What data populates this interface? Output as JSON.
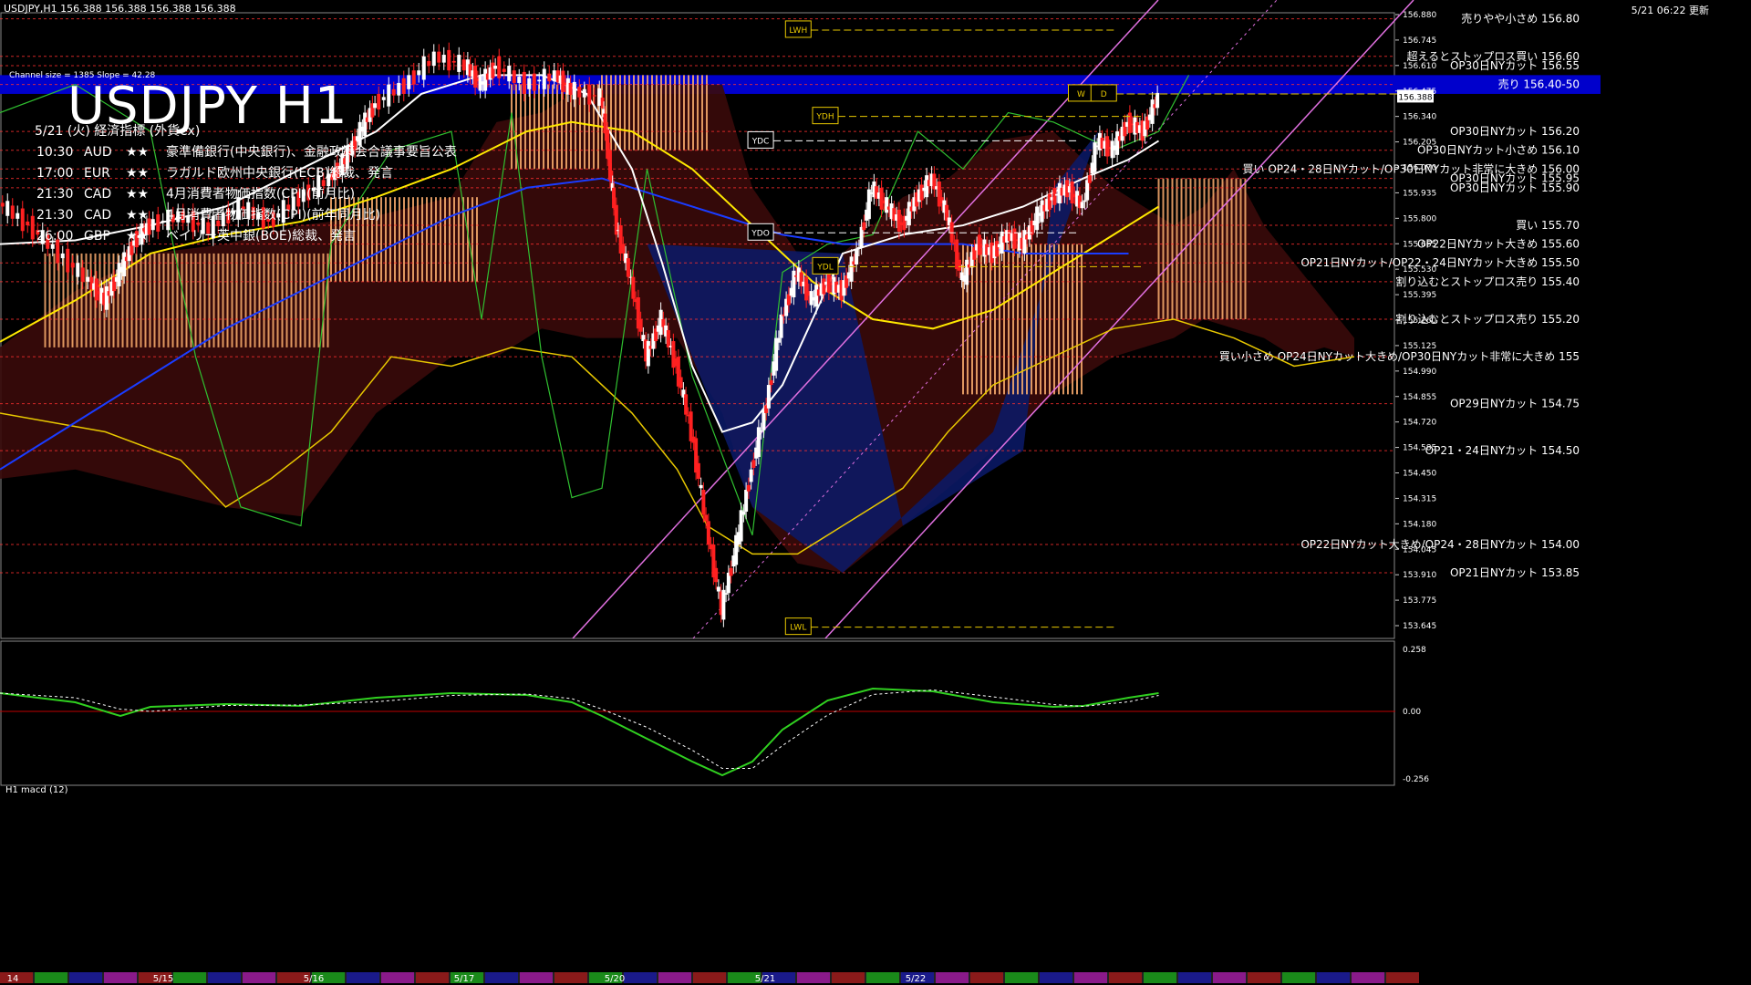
{
  "window": {
    "symbol_bar": "USDJPY,H1  156.388 156.388 156.388 156.388",
    "datetime": "5/21 06:22 更新",
    "title": "USDJPY H1",
    "channel_info": "Channel size = 1385 Slope = 42.28",
    "macd_label": "H1  macd (12)"
  },
  "econ": {
    "heading": "5/21 (火) 経済指標 (外貨ex)",
    "rows": [
      {
        "time": "10:30",
        "ccy": "AUD",
        "stars": "★★",
        "event": "豪準備銀行(中央銀行)、金融政策会合議事要旨公表"
      },
      {
        "time": "17:00",
        "ccy": "EUR",
        "stars": "★★",
        "event": "ラガルド欧州中央銀行(ECB)総裁、発言"
      },
      {
        "time": "21:30",
        "ccy": "CAD",
        "stars": "★★",
        "event": "4月消費者物価指数(CPI)(前月比)"
      },
      {
        "time": "21:30",
        "ccy": "CAD",
        "stars": "★★",
        "event": "4月消費者物価指数(CPI)(前年同月比)"
      },
      {
        "time": "26:00",
        "ccy": "GBP",
        "stars": "★★",
        "event": "ベイリー英中銀(BOE)総裁、発言"
      }
    ]
  },
  "chart_data": {
    "type": "line",
    "title": "USDJPY H1",
    "ylim": [
      153.5,
      156.9
    ],
    "y_ticks": [
      "156.880",
      "156.745",
      "156.610",
      "156.475",
      "156.340",
      "156.205",
      "156.070",
      "155.935",
      "155.800",
      "155.665",
      "155.530",
      "155.395",
      "155.260",
      "155.125",
      "154.990",
      "154.855",
      "154.720",
      "154.585",
      "154.450",
      "154.315",
      "154.180",
      "154.045",
      "153.910",
      "153.775",
      "153.645"
    ],
    "current_price": "156.388",
    "date_labels": [
      {
        "label": "14",
        "x": 0.0
      },
      {
        "label": "5/15",
        "x": 0.1
      },
      {
        "label": "5/16",
        "x": 0.2
      },
      {
        "label": "5/17",
        "x": 0.3
      },
      {
        "label": "5/20",
        "x": 0.4
      },
      {
        "label": "5/21",
        "x": 0.5
      },
      {
        "label": "5/22",
        "x": 0.6
      }
    ],
    "price_series": [
      [
        0.0,
        155.82
      ],
      [
        0.02,
        155.7
      ],
      [
        0.04,
        155.55
      ],
      [
        0.06,
        155.4
      ],
      [
        0.07,
        155.3
      ],
      [
        0.08,
        155.45
      ],
      [
        0.09,
        155.62
      ],
      [
        0.1,
        155.7
      ],
      [
        0.12,
        155.75
      ],
      [
        0.14,
        155.68
      ],
      [
        0.16,
        155.8
      ],
      [
        0.18,
        155.72
      ],
      [
        0.2,
        155.85
      ],
      [
        0.22,
        155.95
      ],
      [
        0.23,
        156.05
      ],
      [
        0.24,
        156.2
      ],
      [
        0.25,
        156.35
      ],
      [
        0.27,
        156.45
      ],
      [
        0.29,
        156.6
      ],
      [
        0.31,
        156.55
      ],
      [
        0.32,
        156.45
      ],
      [
        0.33,
        156.55
      ],
      [
        0.35,
        156.45
      ],
      [
        0.37,
        156.5
      ],
      [
        0.38,
        156.42
      ],
      [
        0.4,
        156.38
      ],
      [
        0.405,
        156.05
      ],
      [
        0.41,
        155.7
      ],
      [
        0.42,
        155.4
      ],
      [
        0.43,
        155.0
      ],
      [
        0.44,
        155.2
      ],
      [
        0.45,
        154.95
      ],
      [
        0.46,
        154.6
      ],
      [
        0.47,
        154.1
      ],
      [
        0.48,
        153.65
      ],
      [
        0.49,
        154.0
      ],
      [
        0.5,
        154.4
      ],
      [
        0.51,
        154.75
      ],
      [
        0.52,
        155.2
      ],
      [
        0.53,
        155.45
      ],
      [
        0.54,
        155.3
      ],
      [
        0.55,
        155.4
      ],
      [
        0.56,
        155.35
      ],
      [
        0.57,
        155.55
      ],
      [
        0.58,
        155.9
      ],
      [
        0.59,
        155.8
      ],
      [
        0.6,
        155.7
      ],
      [
        0.61,
        155.85
      ],
      [
        0.62,
        155.95
      ],
      [
        0.63,
        155.75
      ],
      [
        0.64,
        155.4
      ],
      [
        0.65,
        155.6
      ],
      [
        0.66,
        155.55
      ],
      [
        0.67,
        155.65
      ],
      [
        0.68,
        155.6
      ],
      [
        0.69,
        155.75
      ],
      [
        0.7,
        155.85
      ],
      [
        0.71,
        155.9
      ],
      [
        0.72,
        155.8
      ],
      [
        0.73,
        156.15
      ],
      [
        0.74,
        156.1
      ],
      [
        0.75,
        156.25
      ],
      [
        0.76,
        156.2
      ],
      [
        0.77,
        156.38
      ]
    ],
    "horizontal_levels": [
      {
        "label": "売りやや小さめ 156.80",
        "price": 156.8
      },
      {
        "label": "超えるとストップロス買い 156.60",
        "price": 156.6
      },
      {
        "label": "OP30日NYカット 156.55",
        "price": 156.55
      },
      {
        "label": "売り 156.40-50",
        "price": 156.45
      },
      {
        "label": "OP30日NYカット 156.20",
        "price": 156.2
      },
      {
        "label": "OP30日NYカット小さめ 156.10",
        "price": 156.1
      },
      {
        "label": "買い OP24・28日NYカット/OP30日NYカット非常に大きめ 156.00",
        "price": 156.0
      },
      {
        "label": "OP30日NYカット 155.95",
        "price": 155.95
      },
      {
        "label": "OP30日NYカット 155.90",
        "price": 155.9
      },
      {
        "label": "買い 155.70",
        "price": 155.7
      },
      {
        "label": "OP22日NYカット大きめ 155.60",
        "price": 155.6
      },
      {
        "label": "OP21日NYカット/OP22・24日NYカット大きめ 155.50",
        "price": 155.5
      },
      {
        "label": "割り込むとストップロス売り 155.40",
        "price": 155.4
      },
      {
        "label": "割り込むとストップロス売り 155.20",
        "price": 155.2
      },
      {
        "label": "買い小さめ OP24日NYカット大きめ/OP30日NYカット非常に大きめ 155",
        "price": 155.0
      },
      {
        "label": "OP29日NYカット 154.75",
        "price": 154.75
      },
      {
        "label": "OP21・24日NYカット 154.50",
        "price": 154.5
      },
      {
        "label": "OP22日NYカット大きめ/OP24・28日NYカット 154.00",
        "price": 154.0
      },
      {
        "label": "OP21日NYカット 153.85",
        "price": 153.85
      }
    ],
    "box_labels": [
      "LWH",
      "YDH",
      "YDC",
      "YDO",
      "YDL",
      "LWL",
      "W",
      "D"
    ],
    "macd_ticks": [
      "0.258",
      "0.00",
      "-0.256"
    ],
    "macd_series": [
      [
        0.0,
        0.2
      ],
      [
        0.05,
        0.1
      ],
      [
        0.08,
        -0.05
      ],
      [
        0.1,
        0.05
      ],
      [
        0.15,
        0.08
      ],
      [
        0.2,
        0.06
      ],
      [
        0.25,
        0.15
      ],
      [
        0.3,
        0.2
      ],
      [
        0.35,
        0.18
      ],
      [
        0.38,
        0.1
      ],
      [
        0.4,
        -0.05
      ],
      [
        0.43,
        -0.3
      ],
      [
        0.46,
        -0.55
      ],
      [
        0.48,
        -0.7
      ],
      [
        0.5,
        -0.55
      ],
      [
        0.52,
        -0.2
      ],
      [
        0.55,
        0.12
      ],
      [
        0.58,
        0.25
      ],
      [
        0.62,
        0.22
      ],
      [
        0.66,
        0.1
      ],
      [
        0.7,
        0.05
      ],
      [
        0.72,
        0.06
      ],
      [
        0.75,
        0.15
      ],
      [
        0.77,
        0.2
      ]
    ],
    "colors": {
      "background": "#000000",
      "candle_up": "#ffffff",
      "candle_down": "#ff2020",
      "band_blue": "#0000cc",
      "ma_white": "#ffffff",
      "ma_yellow": "#ffe800",
      "ma_blue": "#1a3cff",
      "cloud_orange": "#ffb070",
      "cloud_blue": "#3a4cff",
      "channel": "#e070e0",
      "level_red": "#ff3030",
      "macd_green": "#30d020",
      "macd_pink": "#ff80b0"
    }
  }
}
